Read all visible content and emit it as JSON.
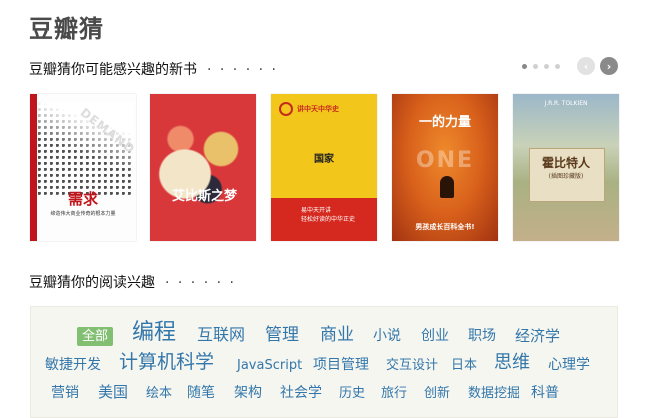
{
  "brand": "豆瓣猜",
  "section_new_books": {
    "title": "豆瓣猜你可能感兴趣的新书",
    "dots": "· · · · · ·"
  },
  "carousel": {
    "prev_icon": "chevron-left-icon",
    "next_icon": "chevron-right-icon",
    "prev_glyph": "‹",
    "next_glyph": "›",
    "page_count": 4,
    "active_page": 1
  },
  "books": [
    {
      "cover_title": "需求",
      "cover_word": "DEMAND",
      "cover_subtitle": "缔造伟大商业传奇的根本力量",
      "accent": "#c0151b"
    },
    {
      "cover_title": "艾比斯之梦",
      "accent": "#d9383a"
    },
    {
      "cover_title": "国家",
      "series": "讲中天中华史",
      "band_text_1": "易中天开讲",
      "band_text_2": "轻松好读的中华正史",
      "accent": "#f3c61b"
    },
    {
      "cover_title": "一的力量",
      "cover_word": "ONE",
      "tag": "男孩成长百科全书!",
      "accent": "#d8601b"
    },
    {
      "cover_title": "霍比特人",
      "author": "J.R.R. TOLKIEN",
      "cover_subtitle": "(插图珍藏版)",
      "accent": "#c9d2b8"
    }
  ],
  "section_interests": {
    "title": "豆瓣猜你的阅读兴趣",
    "dots": "· · · · · ·"
  },
  "tags": [
    {
      "label": "全部",
      "active": true
    },
    {
      "label": "编程"
    },
    {
      "label": "互联网"
    },
    {
      "label": "管理"
    },
    {
      "label": "商业"
    },
    {
      "label": "小说"
    },
    {
      "label": "创业"
    },
    {
      "label": "职场"
    },
    {
      "label": "经济学"
    },
    {
      "label": "敏捷开发"
    },
    {
      "label": "计算机科学"
    },
    {
      "label": "JavaScript"
    },
    {
      "label": "项目管理"
    },
    {
      "label": "交互设计"
    },
    {
      "label": "日本"
    },
    {
      "label": "思维"
    },
    {
      "label": "心理学"
    },
    {
      "label": "营销"
    },
    {
      "label": "美国"
    },
    {
      "label": "绘本"
    },
    {
      "label": "随笔"
    },
    {
      "label": "架构"
    },
    {
      "label": "社会学"
    },
    {
      "label": "历史"
    },
    {
      "label": "旅行"
    },
    {
      "label": "创新"
    },
    {
      "label": "数据挖掘"
    },
    {
      "label": "科普"
    }
  ],
  "colors": {
    "tag_link": "#3377aa",
    "tag_active_bg": "#83bf73",
    "tag_box_bg": "#f6f6f1",
    "brand": "#4a4a4a"
  }
}
